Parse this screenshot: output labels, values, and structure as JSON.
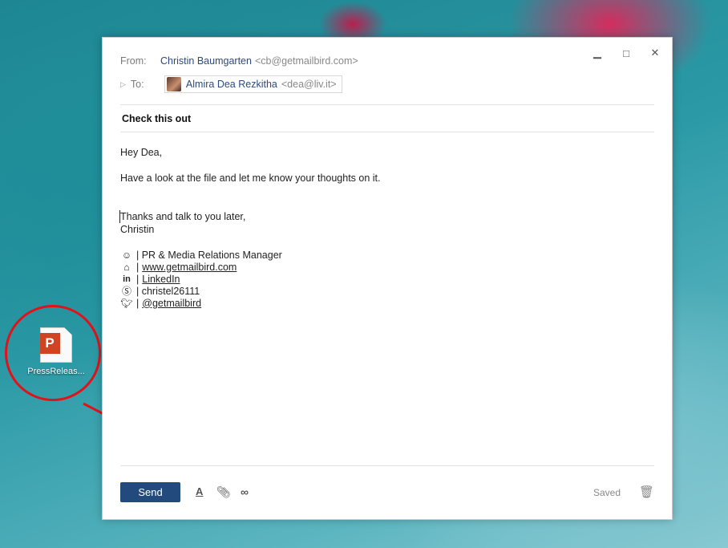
{
  "desktop": {
    "file_label": "PressReleas...",
    "file_icon": "powerpoint-file-icon",
    "accent": "#e0131a"
  },
  "window": {
    "controls": {
      "minimize": "▁",
      "maximize": "□",
      "close": "✕"
    },
    "from_label": "From:",
    "from_name": "Christin Baumgarten",
    "from_addr": "<cb@getmailbird.com>",
    "to_label": "To:",
    "to_name": "Almira Dea Rezkitha",
    "to_addr": "<dea@liv.it>",
    "subject": "Check this out",
    "body": {
      "greeting": "Hey Dea,",
      "line1": "Have a look at the file and let me know your thoughts on it.",
      "closing": "Thanks and talk to you later,",
      "name": "Christin"
    },
    "signature": {
      "title": "| PR & Media Relations Manager",
      "website": "www.getmailbird.com",
      "linkedin": "LinkedIn",
      "skype": "| christel26111",
      "twitter": "@getmailbird",
      "sep": "|"
    },
    "footer": {
      "send_label": "Send",
      "format_icon": "A",
      "saved_label": "Saved"
    },
    "brand_color": "#224a7c"
  }
}
